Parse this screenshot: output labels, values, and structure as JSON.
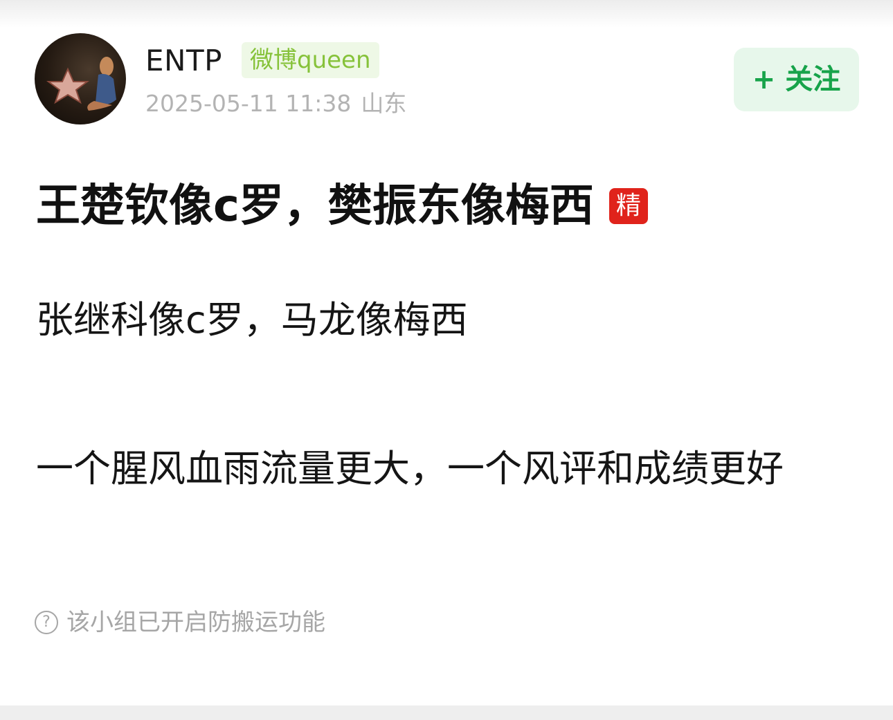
{
  "post": {
    "author": {
      "name": "ENTP",
      "group_badge": "微博queen"
    },
    "timestamp": "2025-05-11 11:38",
    "location": "山东",
    "follow_label": "+ 关注",
    "title": "王楚钦像c罗，樊振东像梅西",
    "featured_badge": "精",
    "paragraphs": [
      "张继科像c罗，马龙像梅西",
      "一个腥风血雨流量更大，一个风评和成绩更好"
    ],
    "notice": {
      "icon": "question-icon",
      "text": "该小组已开启防搬运功能"
    }
  },
  "colors": {
    "follow_text": "#17a34a",
    "follow_bg": "#e7f7eb",
    "group_badge_text": "#86c23a",
    "group_badge_bg": "#eef8e6",
    "featured_badge_bg": "#e0231b",
    "meta_text": "#b3b3b3"
  }
}
